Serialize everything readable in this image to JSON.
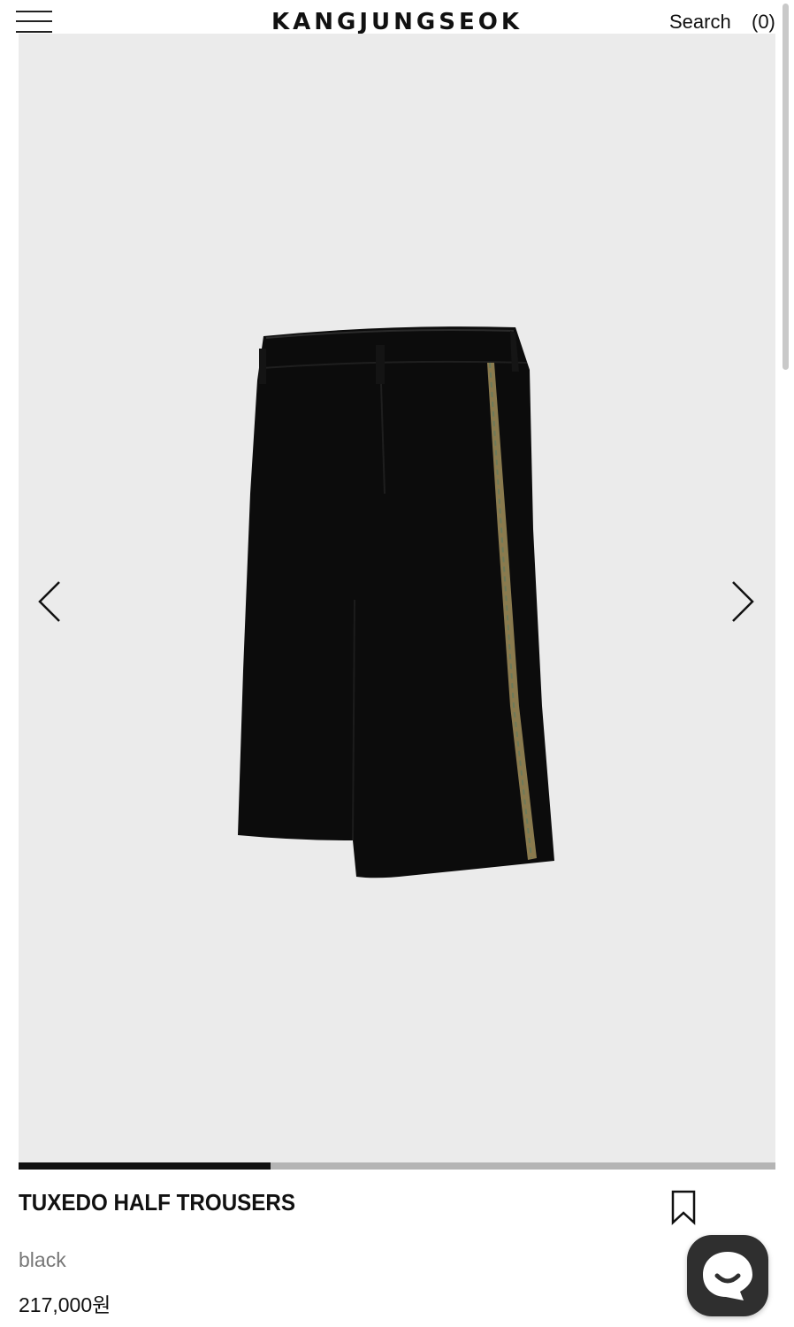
{
  "header": {
    "brand": "KANGJUNGSEOK",
    "search_label": "Search",
    "cart_label": "(0)"
  },
  "slider": {
    "image_alt": "TUXEDO HALF TROUSERS black",
    "progress_fraction": 0.333,
    "colors": {
      "background": "#ebebeb",
      "garment": "#0c0c0c",
      "stripe": "#8a7a4e",
      "progress_track": "#b4b4b4",
      "progress_fill": "#111111"
    }
  },
  "product": {
    "name": "TUXEDO HALF TROUSERS",
    "color": "black",
    "price": "217,000원"
  },
  "icons": {
    "menu": "hamburger-menu-icon",
    "prev": "chevron-left-icon",
    "next": "chevron-right-icon",
    "wishlist": "bookmark-icon",
    "chat": "chat-bubble-icon"
  }
}
